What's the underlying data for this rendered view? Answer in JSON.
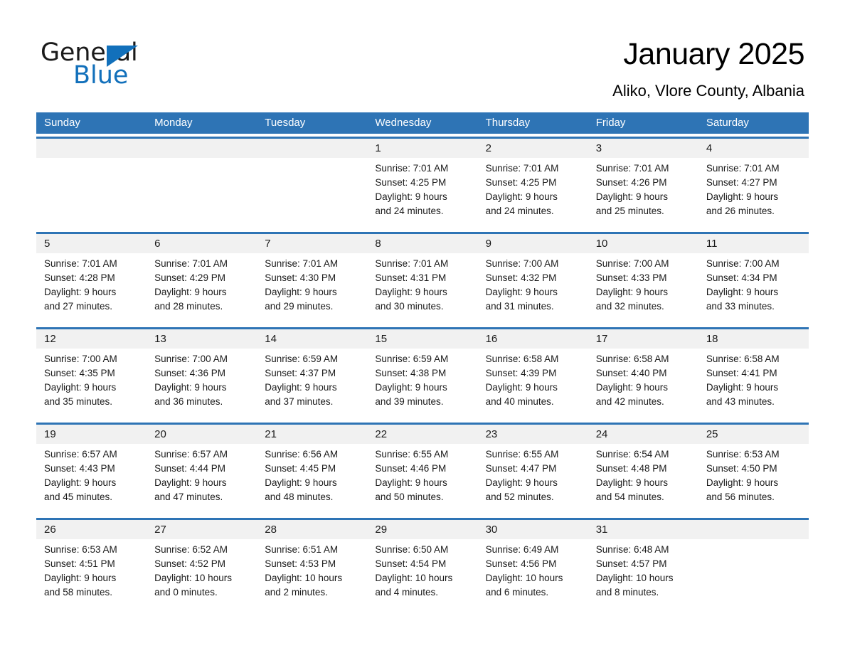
{
  "brand": {
    "name_part1": "General",
    "name_part2": "Blue",
    "logo_color": "#1270bb",
    "triangle_icon": "triangle-icon"
  },
  "header": {
    "month_title": "January 2025",
    "location": "Aliko, Vlore County, Albania"
  },
  "theme": {
    "header_blue": "#2e74b5",
    "daynum_band": "#f1f1f1",
    "text": "#1a1a1a"
  },
  "weekdays": [
    "Sunday",
    "Monday",
    "Tuesday",
    "Wednesday",
    "Thursday",
    "Friday",
    "Saturday"
  ],
  "weeks": [
    {
      "days": [
        {
          "num": "",
          "sunrise": "",
          "sunset": "",
          "daylight_line1": "",
          "daylight_line2": ""
        },
        {
          "num": "",
          "sunrise": "",
          "sunset": "",
          "daylight_line1": "",
          "daylight_line2": ""
        },
        {
          "num": "",
          "sunrise": "",
          "sunset": "",
          "daylight_line1": "",
          "daylight_line2": ""
        },
        {
          "num": "1",
          "sunrise": "Sunrise: 7:01 AM",
          "sunset": "Sunset: 4:25 PM",
          "daylight_line1": "Daylight: 9 hours",
          "daylight_line2": "and 24 minutes."
        },
        {
          "num": "2",
          "sunrise": "Sunrise: 7:01 AM",
          "sunset": "Sunset: 4:25 PM",
          "daylight_line1": "Daylight: 9 hours",
          "daylight_line2": "and 24 minutes."
        },
        {
          "num": "3",
          "sunrise": "Sunrise: 7:01 AM",
          "sunset": "Sunset: 4:26 PM",
          "daylight_line1": "Daylight: 9 hours",
          "daylight_line2": "and 25 minutes."
        },
        {
          "num": "4",
          "sunrise": "Sunrise: 7:01 AM",
          "sunset": "Sunset: 4:27 PM",
          "daylight_line1": "Daylight: 9 hours",
          "daylight_line2": "and 26 minutes."
        }
      ]
    },
    {
      "days": [
        {
          "num": "5",
          "sunrise": "Sunrise: 7:01 AM",
          "sunset": "Sunset: 4:28 PM",
          "daylight_line1": "Daylight: 9 hours",
          "daylight_line2": "and 27 minutes."
        },
        {
          "num": "6",
          "sunrise": "Sunrise: 7:01 AM",
          "sunset": "Sunset: 4:29 PM",
          "daylight_line1": "Daylight: 9 hours",
          "daylight_line2": "and 28 minutes."
        },
        {
          "num": "7",
          "sunrise": "Sunrise: 7:01 AM",
          "sunset": "Sunset: 4:30 PM",
          "daylight_line1": "Daylight: 9 hours",
          "daylight_line2": "and 29 minutes."
        },
        {
          "num": "8",
          "sunrise": "Sunrise: 7:01 AM",
          "sunset": "Sunset: 4:31 PM",
          "daylight_line1": "Daylight: 9 hours",
          "daylight_line2": "and 30 minutes."
        },
        {
          "num": "9",
          "sunrise": "Sunrise: 7:00 AM",
          "sunset": "Sunset: 4:32 PM",
          "daylight_line1": "Daylight: 9 hours",
          "daylight_line2": "and 31 minutes."
        },
        {
          "num": "10",
          "sunrise": "Sunrise: 7:00 AM",
          "sunset": "Sunset: 4:33 PM",
          "daylight_line1": "Daylight: 9 hours",
          "daylight_line2": "and 32 minutes."
        },
        {
          "num": "11",
          "sunrise": "Sunrise: 7:00 AM",
          "sunset": "Sunset: 4:34 PM",
          "daylight_line1": "Daylight: 9 hours",
          "daylight_line2": "and 33 minutes."
        }
      ]
    },
    {
      "days": [
        {
          "num": "12",
          "sunrise": "Sunrise: 7:00 AM",
          "sunset": "Sunset: 4:35 PM",
          "daylight_line1": "Daylight: 9 hours",
          "daylight_line2": "and 35 minutes."
        },
        {
          "num": "13",
          "sunrise": "Sunrise: 7:00 AM",
          "sunset": "Sunset: 4:36 PM",
          "daylight_line1": "Daylight: 9 hours",
          "daylight_line2": "and 36 minutes."
        },
        {
          "num": "14",
          "sunrise": "Sunrise: 6:59 AM",
          "sunset": "Sunset: 4:37 PM",
          "daylight_line1": "Daylight: 9 hours",
          "daylight_line2": "and 37 minutes."
        },
        {
          "num": "15",
          "sunrise": "Sunrise: 6:59 AM",
          "sunset": "Sunset: 4:38 PM",
          "daylight_line1": "Daylight: 9 hours",
          "daylight_line2": "and 39 minutes."
        },
        {
          "num": "16",
          "sunrise": "Sunrise: 6:58 AM",
          "sunset": "Sunset: 4:39 PM",
          "daylight_line1": "Daylight: 9 hours",
          "daylight_line2": "and 40 minutes."
        },
        {
          "num": "17",
          "sunrise": "Sunrise: 6:58 AM",
          "sunset": "Sunset: 4:40 PM",
          "daylight_line1": "Daylight: 9 hours",
          "daylight_line2": "and 42 minutes."
        },
        {
          "num": "18",
          "sunrise": "Sunrise: 6:58 AM",
          "sunset": "Sunset: 4:41 PM",
          "daylight_line1": "Daylight: 9 hours",
          "daylight_line2": "and 43 minutes."
        }
      ]
    },
    {
      "days": [
        {
          "num": "19",
          "sunrise": "Sunrise: 6:57 AM",
          "sunset": "Sunset: 4:43 PM",
          "daylight_line1": "Daylight: 9 hours",
          "daylight_line2": "and 45 minutes."
        },
        {
          "num": "20",
          "sunrise": "Sunrise: 6:57 AM",
          "sunset": "Sunset: 4:44 PM",
          "daylight_line1": "Daylight: 9 hours",
          "daylight_line2": "and 47 minutes."
        },
        {
          "num": "21",
          "sunrise": "Sunrise: 6:56 AM",
          "sunset": "Sunset: 4:45 PM",
          "daylight_line1": "Daylight: 9 hours",
          "daylight_line2": "and 48 minutes."
        },
        {
          "num": "22",
          "sunrise": "Sunrise: 6:55 AM",
          "sunset": "Sunset: 4:46 PM",
          "daylight_line1": "Daylight: 9 hours",
          "daylight_line2": "and 50 minutes."
        },
        {
          "num": "23",
          "sunrise": "Sunrise: 6:55 AM",
          "sunset": "Sunset: 4:47 PM",
          "daylight_line1": "Daylight: 9 hours",
          "daylight_line2": "and 52 minutes."
        },
        {
          "num": "24",
          "sunrise": "Sunrise: 6:54 AM",
          "sunset": "Sunset: 4:48 PM",
          "daylight_line1": "Daylight: 9 hours",
          "daylight_line2": "and 54 minutes."
        },
        {
          "num": "25",
          "sunrise": "Sunrise: 6:53 AM",
          "sunset": "Sunset: 4:50 PM",
          "daylight_line1": "Daylight: 9 hours",
          "daylight_line2": "and 56 minutes."
        }
      ]
    },
    {
      "days": [
        {
          "num": "26",
          "sunrise": "Sunrise: 6:53 AM",
          "sunset": "Sunset: 4:51 PM",
          "daylight_line1": "Daylight: 9 hours",
          "daylight_line2": "and 58 minutes."
        },
        {
          "num": "27",
          "sunrise": "Sunrise: 6:52 AM",
          "sunset": "Sunset: 4:52 PM",
          "daylight_line1": "Daylight: 10 hours",
          "daylight_line2": "and 0 minutes."
        },
        {
          "num": "28",
          "sunrise": "Sunrise: 6:51 AM",
          "sunset": "Sunset: 4:53 PM",
          "daylight_line1": "Daylight: 10 hours",
          "daylight_line2": "and 2 minutes."
        },
        {
          "num": "29",
          "sunrise": "Sunrise: 6:50 AM",
          "sunset": "Sunset: 4:54 PM",
          "daylight_line1": "Daylight: 10 hours",
          "daylight_line2": "and 4 minutes."
        },
        {
          "num": "30",
          "sunrise": "Sunrise: 6:49 AM",
          "sunset": "Sunset: 4:56 PM",
          "daylight_line1": "Daylight: 10 hours",
          "daylight_line2": "and 6 minutes."
        },
        {
          "num": "31",
          "sunrise": "Sunrise: 6:48 AM",
          "sunset": "Sunset: 4:57 PM",
          "daylight_line1": "Daylight: 10 hours",
          "daylight_line2": "and 8 minutes."
        },
        {
          "num": "",
          "sunrise": "",
          "sunset": "",
          "daylight_line1": "",
          "daylight_line2": ""
        }
      ]
    }
  ]
}
